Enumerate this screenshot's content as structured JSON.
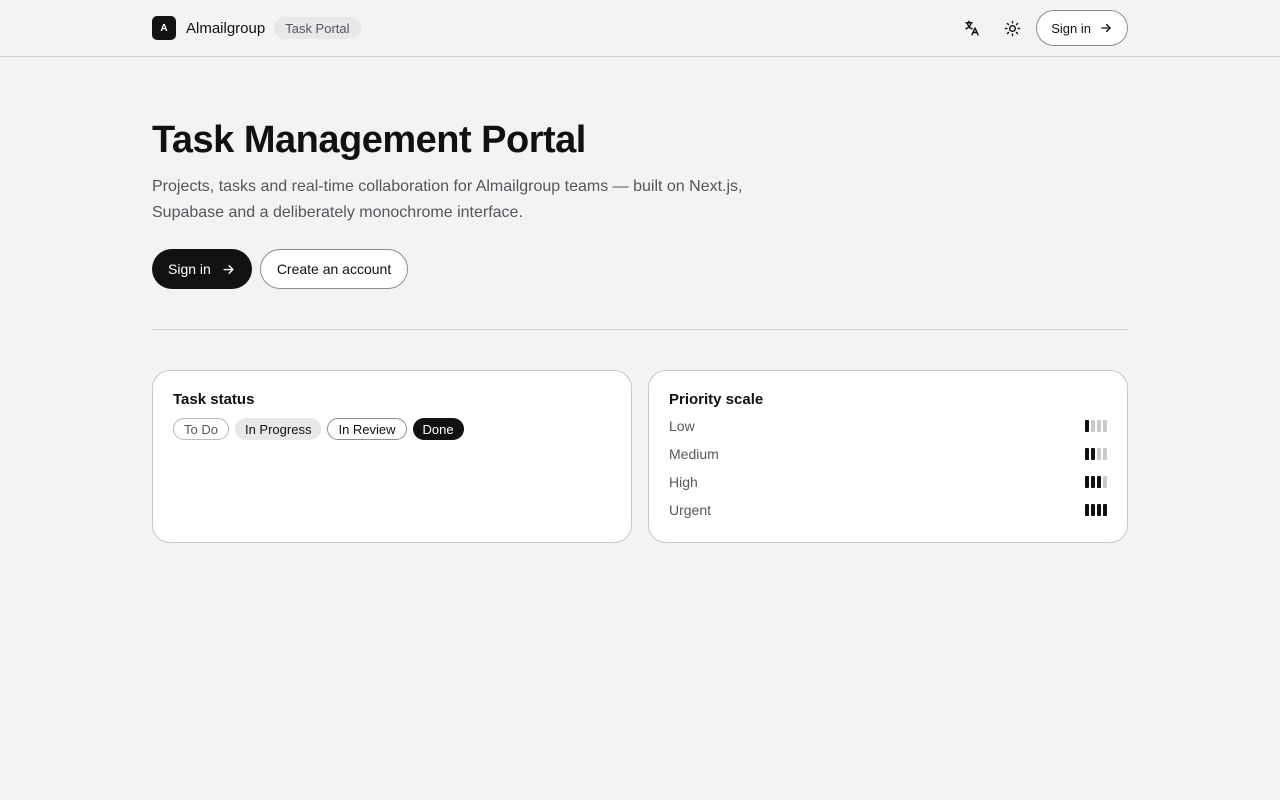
{
  "brand": {
    "logo_letter": "A",
    "name": "Almailgroup",
    "chip": "Task Portal"
  },
  "topbar": {
    "translate_icon": "translate-icon",
    "theme_icon": "sun-icon",
    "signin_label": "Sign in"
  },
  "hero": {
    "title": "Task Management Portal",
    "description": "Projects, tasks and real-time collaboration for Almailgroup teams — built on Next.js, Supabase and a deliberately monochrome interface.",
    "primary_label": "Sign in",
    "secondary_label": "Create an account"
  },
  "status_card": {
    "title": "Task status",
    "statuses": [
      "To Do",
      "In Progress",
      "In Review",
      "Done"
    ]
  },
  "priority_card": {
    "title": "Priority scale",
    "levels": [
      {
        "label": "Low",
        "level": 1,
        "max": 4
      },
      {
        "label": "Medium",
        "level": 2,
        "max": 4
      },
      {
        "label": "High",
        "level": 3,
        "max": 4
      },
      {
        "label": "Urgent",
        "level": 4,
        "max": 4
      }
    ]
  },
  "colors": {
    "primary": "#111114",
    "muted": "#55555c",
    "background": "#f3f3f3"
  }
}
